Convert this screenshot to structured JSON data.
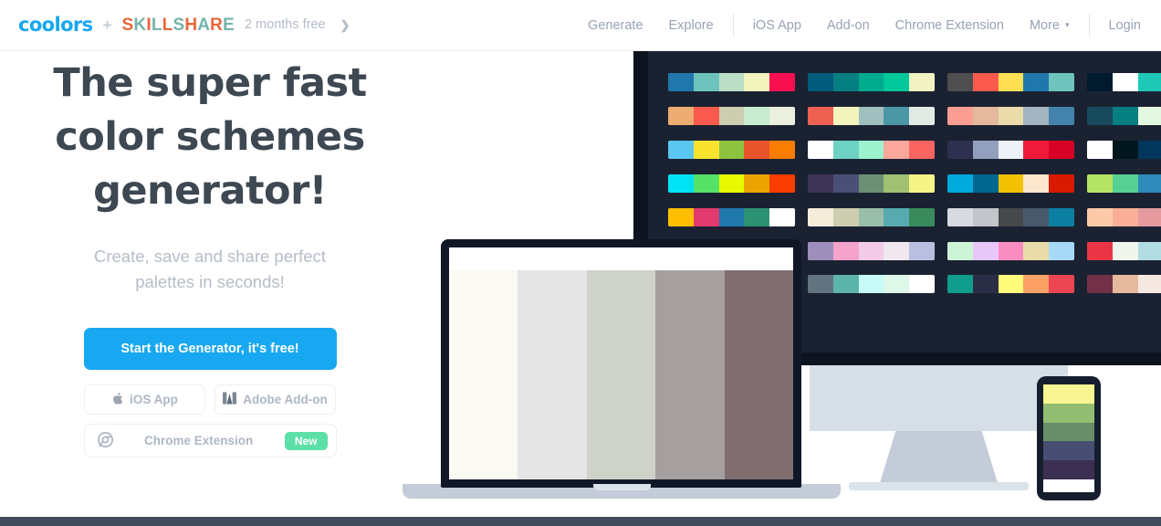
{
  "header": {
    "logo": "coolors",
    "plus": "+",
    "partner": "SKILLSHARE",
    "promo": "2 months free",
    "promo_arrow": "❯",
    "nav_primary": [
      {
        "label": "Generate",
        "name": "nav-generate"
      },
      {
        "label": "Explore",
        "name": "nav-explore"
      }
    ],
    "nav_secondary": [
      {
        "label": "iOS App",
        "name": "nav-ios-app"
      },
      {
        "label": "Add-on",
        "name": "nav-add-on"
      },
      {
        "label": "Chrome Extension",
        "name": "nav-chrome-extension"
      }
    ],
    "more_label": "More",
    "more_chevron": "▾",
    "login_label": "Login"
  },
  "hero": {
    "headline_line1": "The super fast",
    "headline_line2": "color schemes",
    "headline_line3": "generator!",
    "subhead_line1": "Create, save and share perfect",
    "subhead_line2": "palettes in seconds!",
    "cta_label": "Start the Generator, it's free!",
    "ios_label": "iOS App",
    "adobe_label": "Adobe Add-on",
    "chrome_label": "Chrome Extension",
    "new_badge": "New"
  },
  "colors": {
    "brand_blue": "#17a7f0",
    "cta_blue": "#18a8f1",
    "skillshare_orange": "#e8653a",
    "skillshare_teal": "#74b4ad",
    "headline_slate": "#3d4852",
    "muted_gray": "#b5bdc8",
    "panel_dark": "#1a2232",
    "panel_dark_outer": "#0d1420",
    "badge_green": "#5ce0a8",
    "footer_slate": "#3f4a5a",
    "device_gray": "#c3ccd8",
    "monitor_screen": "#d6dfe7"
  },
  "palette_wall": {
    "columns": 3,
    "rows": [
      [
        "#2077ab",
        "#6ec4bd",
        "#bbdec6",
        "#f2f3bd",
        "#f90f4f"
      ],
      [
        "#035b7c",
        "#067f82",
        "#00ab8e",
        "#00c89a",
        "#f1f3c2"
      ],
      [
        "#4f4f4f",
        "#fb5a4c",
        "#ffdf54",
        "#2077ab",
        "#6ec4bd"
      ],
      [
        "#001a2e",
        "#ffffff",
        "#1fc8b6",
        "#1c4b60",
        "#0a7e94"
      ],
      [
        "#eeab72",
        "#fb5a4c",
        "#cdcdaf",
        "#c8ecd0",
        "#eaefe0"
      ],
      [
        "#ec6152",
        "#f3f3bc",
        "#a0c0bf",
        "#4c97a6",
        "#e2eae5"
      ],
      [
        "#fb9e93",
        "#e4b99e",
        "#e9dcaa",
        "#a3b5c1",
        "#4383ab"
      ],
      [
        "#17495c",
        "#067f82",
        "#e4f7e2",
        "#1e7e96",
        "#1a5d73"
      ],
      [
        "#5bc6f0",
        "#f8e430",
        "#8dc33f",
        "#e8552a",
        "#f97d00"
      ],
      [
        "#ffffff",
        "#6ed2c2",
        "#9df3cf",
        "#fba79b",
        "#fb6460"
      ],
      [
        "#2f3050",
        "#93a0bd",
        "#eef1f5",
        "#f01a3b",
        "#d70025"
      ],
      [
        "#ffffff",
        "#00161c",
        "#02365c",
        "#0d5378",
        "#0f7ea0"
      ],
      [
        "#00e3f7",
        "#56e268",
        "#e8fa00",
        "#eaa300",
        "#fa3d00"
      ],
      [
        "#3c3355",
        "#4a5075",
        "#6c8f74",
        "#a1c072",
        "#f4f585"
      ],
      [
        "#00aadc",
        "#00678f",
        "#f2c200",
        "#fde7cd",
        "#d81a00"
      ],
      [
        "#b6e465",
        "#57d093",
        "#2e8ab8",
        "#1a6f9a",
        "#11567c"
      ],
      [
        "#ffbf00",
        "#e23a6e",
        "#2077ab",
        "#2d9272",
        "#ffffff"
      ],
      [
        "#f5edd9",
        "#cdcdaf",
        "#98bda8",
        "#57aab0",
        "#398b5c"
      ],
      [
        "#d7dade",
        "#c2c5c9",
        "#46494b",
        "#47596a",
        "#0d7fa2"
      ],
      [
        "#fdcaa9",
        "#f9ae98",
        "#e59b9e",
        "#c58794",
        "#a9748a"
      ],
      [
        "#d9e1dd",
        "#fdeddc",
        "#ffcfd7",
        "#f7adb6",
        "#a28a8e"
      ],
      [
        "#fa4e00",
        "#8aa400",
        "#f7bf00",
        "#eda000",
        "#c52d00"
      ],
      [
        "#fa4e00",
        "#ffae00",
        "#00a9f0",
        "#0083c4",
        "#00619a"
      ],
      [
        "#f9f3e7",
        "#e8d9c2",
        "#d8c0a2",
        "#b79a7a",
        "#8e7355"
      ]
    ],
    "rows_lower": [
      [
        "#9e8fbd",
        "#f4a3cb",
        "#f3cbe8",
        "#f0e7ef",
        "#b9bfdf"
      ],
      [
        "#cdf4d6",
        "#e8c7f9",
        "#f98cc0",
        "#e9dcaa",
        "#a7d9f7"
      ],
      [
        "#ea3546",
        "#f0f6ed",
        "#b1dde3",
        "#81c7d4",
        "#4ba3b5"
      ],
      [
        "#61747f",
        "#5cb5ab",
        "#c8fbf7",
        "#ddf8e8",
        "#ffffff"
      ],
      [
        "#0f9d8c",
        "#2c2e45",
        "#fdfb79",
        "#fb9f65",
        "#ec4553"
      ],
      [
        "#733047",
        "#e4b99e",
        "#f4e8e1",
        "#cdb8a6",
        "#9e8574"
      ]
    ]
  },
  "laptop_palette": [
    "#fbfaf2",
    "#e5e5e5",
    "#cfd2c9",
    "#a5a09f",
    "#7f6d70"
  ],
  "phone_palette": [
    "#f6f591",
    "#92bd72",
    "#688f69",
    "#474e72",
    "#3b3052"
  ]
}
